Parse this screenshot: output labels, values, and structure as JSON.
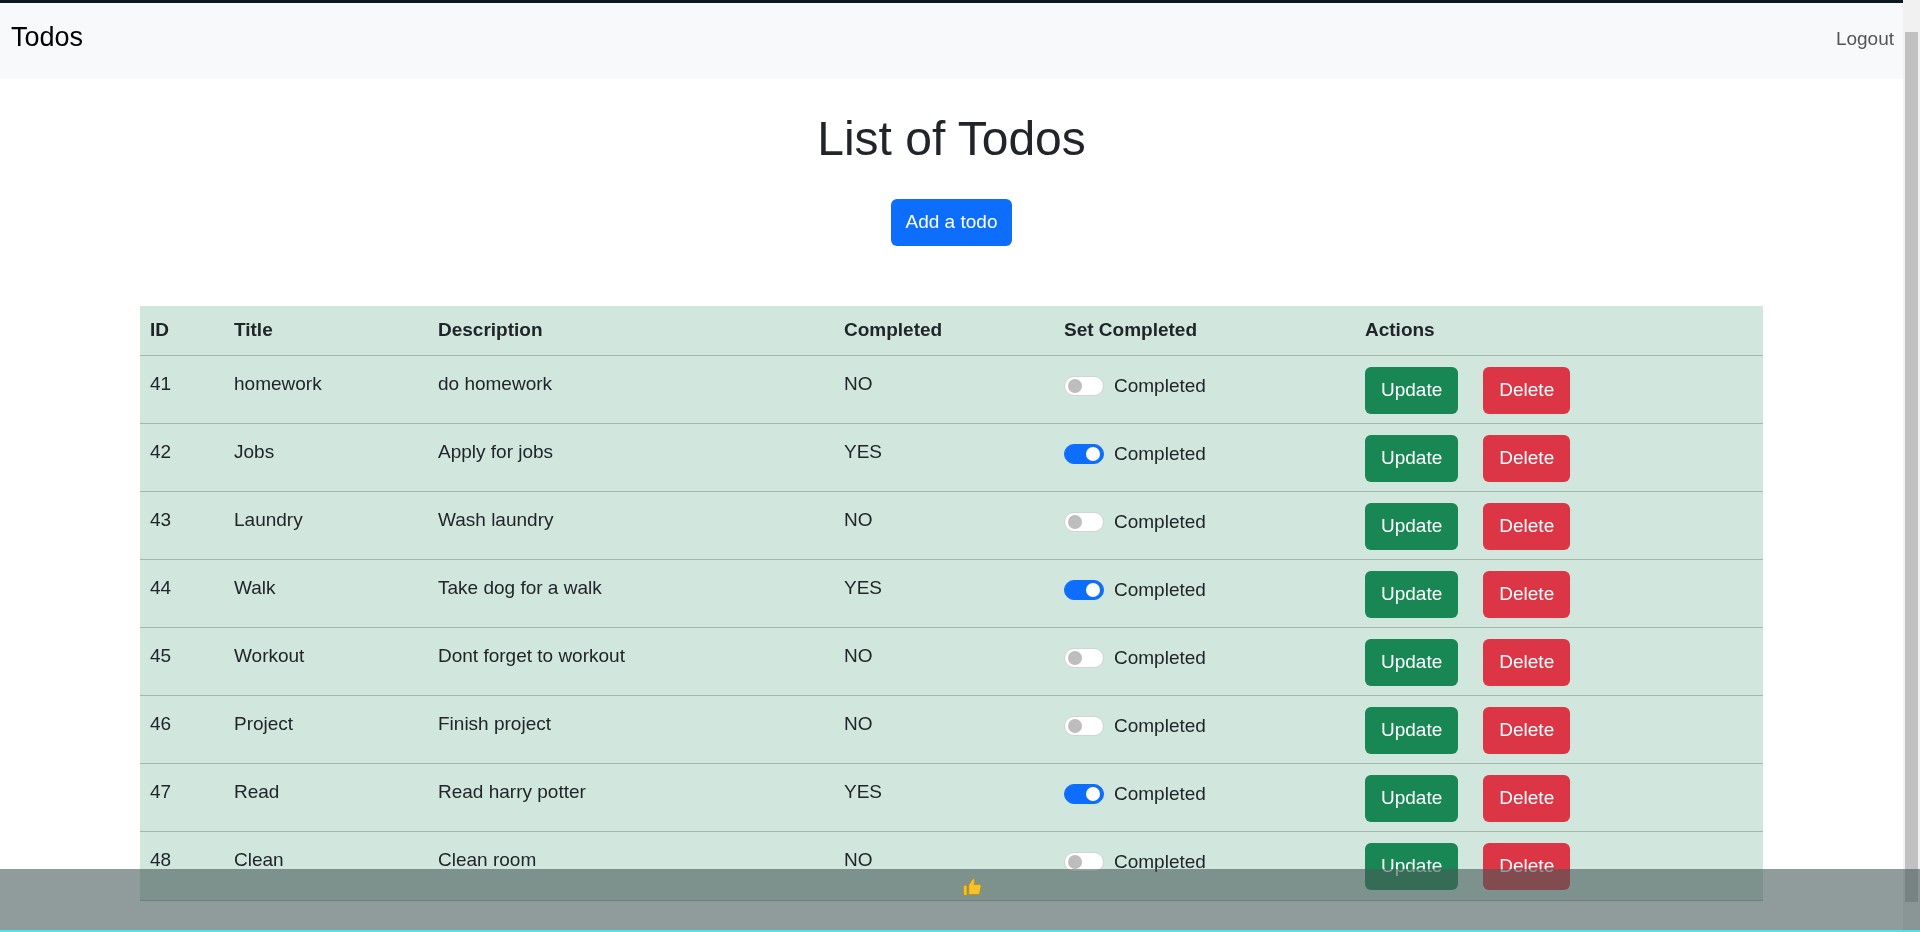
{
  "navbar": {
    "brand": "Todos",
    "logout": "Logout"
  },
  "heading": "List of Todos",
  "add_button": "Add a todo",
  "table": {
    "columns": [
      "ID",
      "Title",
      "Description",
      "Completed",
      "Set Completed",
      "Actions"
    ],
    "rows": [
      {
        "id": "41",
        "title": "homework",
        "description": "do homework",
        "completed": "NO",
        "toggle_label": "Completed",
        "on": false,
        "update": "Update",
        "delete": "Delete"
      },
      {
        "id": "42",
        "title": "Jobs",
        "description": "Apply for jobs",
        "completed": "YES",
        "toggle_label": "Completed",
        "on": true,
        "update": "Update",
        "delete": "Delete"
      },
      {
        "id": "43",
        "title": "Laundry",
        "description": "Wash laundry",
        "completed": "NO",
        "toggle_label": "Completed",
        "on": false,
        "update": "Update",
        "delete": "Delete"
      },
      {
        "id": "44",
        "title": "Walk",
        "description": "Take dog for a walk",
        "completed": "YES",
        "toggle_label": "Completed",
        "on": true,
        "update": "Update",
        "delete": "Delete"
      },
      {
        "id": "45",
        "title": "Workout",
        "description": "Dont forget to workout",
        "completed": "NO",
        "toggle_label": "Completed",
        "on": false,
        "update": "Update",
        "delete": "Delete"
      },
      {
        "id": "46",
        "title": "Project",
        "description": "Finish project",
        "completed": "NO",
        "toggle_label": "Completed",
        "on": false,
        "update": "Update",
        "delete": "Delete"
      },
      {
        "id": "47",
        "title": "Read",
        "description": "Read harry potter",
        "completed": "YES",
        "toggle_label": "Completed",
        "on": true,
        "update": "Update",
        "delete": "Delete"
      },
      {
        "id": "48",
        "title": "Clean",
        "description": "Clean room",
        "completed": "NO",
        "toggle_label": "Completed",
        "on": false,
        "update": "Update",
        "delete": "Delete"
      }
    ]
  }
}
